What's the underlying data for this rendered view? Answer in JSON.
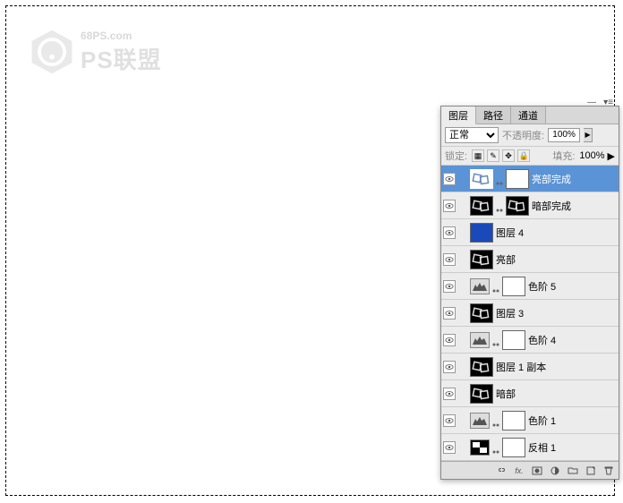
{
  "watermark": {
    "url": "68PS.com",
    "brand": "PS联盟"
  },
  "panel": {
    "tabs": [
      "图层",
      "路径",
      "通道"
    ],
    "active_tab": 0,
    "blend_mode": "正常",
    "opacity_label": "不透明度:",
    "opacity_value": "100%",
    "fill_label": "填充:",
    "fill_value": "100%",
    "lock_label": "锁定:"
  },
  "layers": [
    {
      "name": "亮部完成",
      "has_mask": true,
      "mask_dark": false,
      "selected": true,
      "thumb": "ice"
    },
    {
      "name": "暗部完成",
      "has_mask": true,
      "mask_dark": true,
      "thumb": "ice-dark"
    },
    {
      "name": "图层 4",
      "thumb": "blue"
    },
    {
      "name": "亮部",
      "thumb": "ice-dark"
    },
    {
      "name": "色阶 5",
      "adjust": true,
      "has_mask": true
    },
    {
      "name": "图层 3",
      "thumb": "ice-dark"
    },
    {
      "name": "色阶 4",
      "adjust": true,
      "has_mask": true
    },
    {
      "name": "图层 1 副本",
      "thumb": "ice-dark"
    },
    {
      "name": "暗部",
      "thumb": "ice-dark"
    },
    {
      "name": "色阶 1",
      "adjust": true,
      "has_mask": true
    },
    {
      "name": "反相 1",
      "adjust": true,
      "invert": true,
      "has_mask": true
    }
  ],
  "footer_icons": [
    "link",
    "fx",
    "mask",
    "adjust",
    "group",
    "new",
    "trash"
  ]
}
